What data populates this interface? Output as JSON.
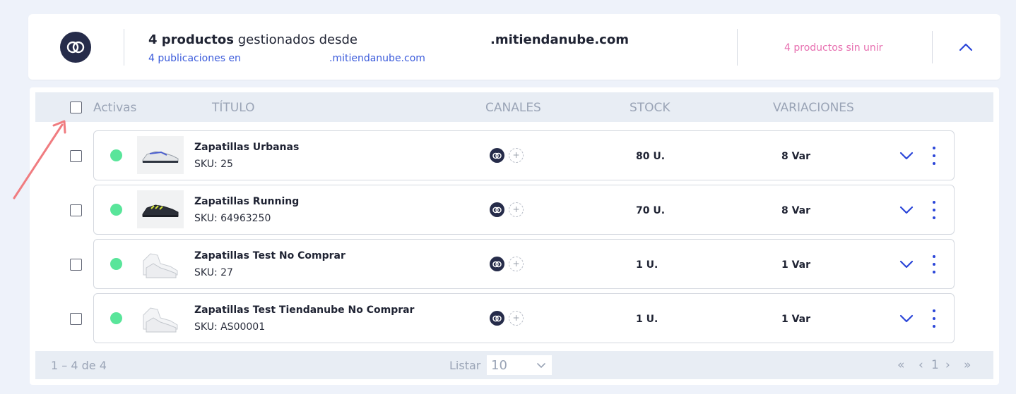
{
  "header": {
    "count_bold": "4 productos",
    "count_rest": " gestionados desde",
    "domain": ".mitiendanube.com",
    "publications_label": "4 publicaciones en",
    "publications_domain": ".mitiendanube.com",
    "unjoined": "4 productos sin unir"
  },
  "table": {
    "col_active": "Activas",
    "col_title": "TÍTULO",
    "col_channels": "CANALES",
    "col_stock": "STOCK",
    "col_variations": "VARIACIONES"
  },
  "products": [
    {
      "name": "Zapatillas Urbanas",
      "sku": "SKU: 25",
      "stock": "80 U.",
      "variations": "8 Var",
      "status_color": "#59e59a"
    },
    {
      "name": "Zapatillas Running",
      "sku": "SKU: 64963250",
      "stock": "70 U.",
      "variations": "8 Var",
      "status_color": "#59e59a"
    },
    {
      "name": "Zapatillas Test No Comprar",
      "sku": "SKU: 27",
      "stock": "1 U.",
      "variations": "1 Var",
      "status_color": "#59e59a"
    },
    {
      "name": "Zapatillas Test Tiendanube No Comprar",
      "sku": "SKU: AS00001",
      "stock": "1 U.",
      "variations": "1 Var",
      "status_color": "#59e59a"
    }
  ],
  "footer": {
    "range": "1 – 4 de 4",
    "list_label": "Listar",
    "page_size": "10",
    "first": "«",
    "prev": "‹",
    "page": "1",
    "next": "›",
    "last": "»"
  },
  "colors": {
    "accent": "#2a45d8",
    "link": "#3b5bdb",
    "pink": "#e76fb0",
    "active": "#59e59a",
    "annotation_arrow": "#f07c80"
  },
  "icons": {
    "brand": "linked-rings-icon",
    "expand": "chevron-down-icon",
    "collapse": "chevron-up-icon",
    "menu": "kebab-menu-icon",
    "annotation": "red-arrow-icon"
  }
}
